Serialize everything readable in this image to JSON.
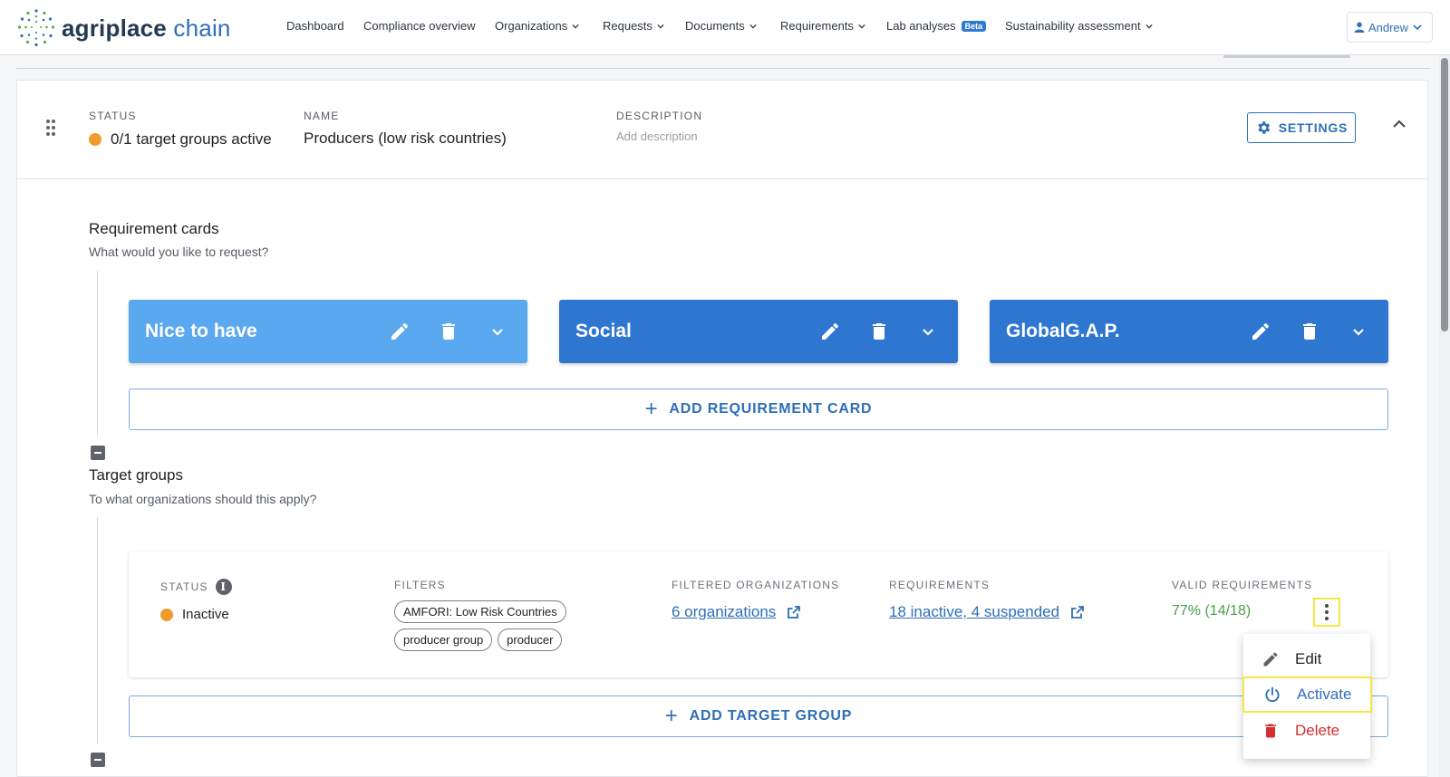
{
  "nav": {
    "logo_bold": "agriplace",
    "logo_light": "chain",
    "items": [
      {
        "label": "Dashboard"
      },
      {
        "label": "Compliance overview"
      },
      {
        "label": "Organizations"
      },
      {
        "label": "Requests"
      },
      {
        "label": "Documents"
      },
      {
        "label": "Requirements"
      },
      {
        "label": "Lab analyses",
        "badge": "Beta"
      },
      {
        "label": "Sustainability assessment"
      }
    ],
    "user": "Andrew"
  },
  "group": {
    "status_label": "STATUS",
    "status_value": "0/1 target groups active",
    "name_label": "NAME",
    "name_value": "Producers (low risk countries)",
    "description_label": "DESCRIPTION",
    "description_placeholder": "Add description",
    "settings_label": "SETTINGS"
  },
  "requirement_cards": {
    "title": "Requirement cards",
    "subtitle": "What would you like to request?",
    "cards": [
      {
        "title": "Nice to have"
      },
      {
        "title": "Social"
      },
      {
        "title": "GlobalG.A.P."
      }
    ],
    "add_label": "ADD REQUIREMENT CARD"
  },
  "target_groups": {
    "title": "Target groups",
    "subtitle": "To what organizations should this apply?",
    "row": {
      "status_label": "STATUS",
      "status_value": "Inactive",
      "filters_label": "FILTERS",
      "filters": [
        "AMFORI: Low Risk Countries",
        "producer group",
        "producer"
      ],
      "filtered_label": "FILTERED ORGANIZATIONS",
      "filtered_value": "6 organizations",
      "requirements_label": "REQUIREMENTS",
      "requirements_value": "18 inactive, 4 suspended",
      "valid_label": "VALID REQUIREMENTS",
      "valid_value": "77% (14/18)"
    },
    "add_label": "ADD TARGET GROUP"
  },
  "menu": {
    "edit": "Edit",
    "activate": "Activate",
    "delete": "Delete"
  },
  "colors": {
    "accent": "#2e6fb7",
    "card_light": "#5aa8ef",
    "card_dark": "#2e76cf",
    "status_orange": "#f19a2e",
    "valid_green": "#4aa046",
    "delete_red": "#d32f2f",
    "highlight": "#f5e642"
  }
}
